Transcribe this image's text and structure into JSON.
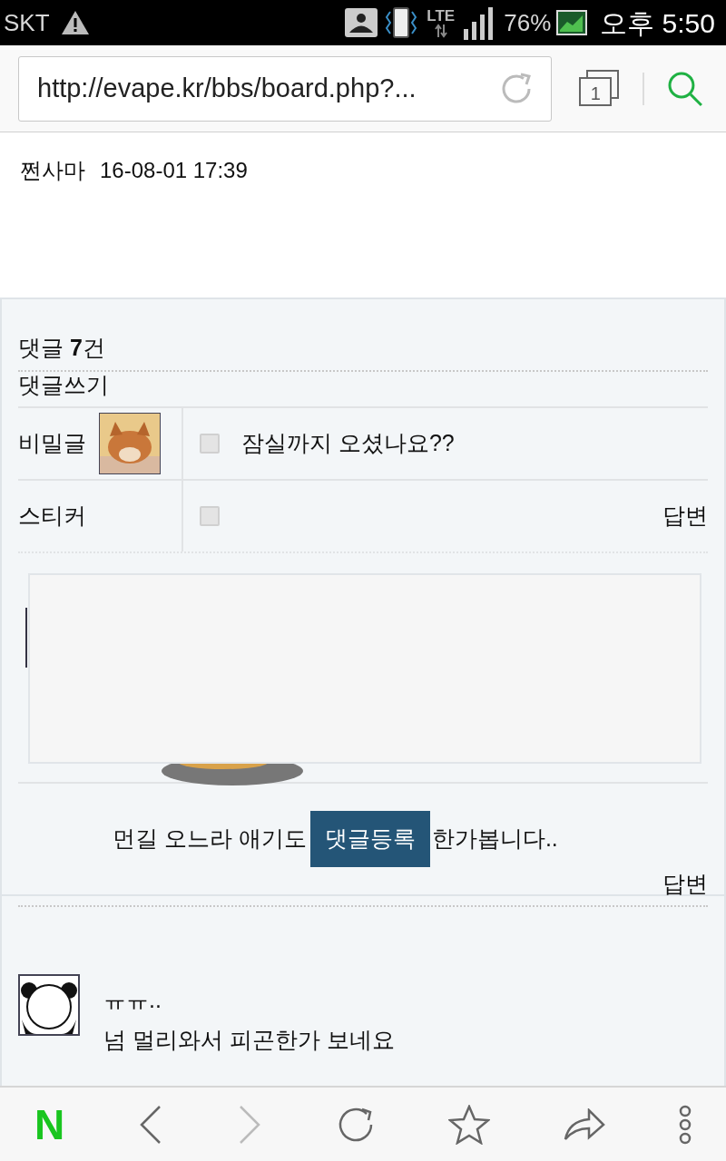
{
  "status_bar": {
    "carrier": "SKT",
    "network": "LTE",
    "battery": "76%",
    "time": "오후 5:50"
  },
  "address_bar": {
    "url": "http://evape.kr/bbs/board.php?...",
    "tab_count": "1"
  },
  "post_meta": {
    "author": "쩐사마",
    "date": "16-08-01 17:39"
  },
  "comment_form": {
    "count_label": "댓글 **7**건",
    "heading": "댓글쓰기",
    "options": [
      {
        "label": "비밀글",
        "checked": false
      },
      {
        "label": "스티커",
        "checked": false
      }
    ],
    "submit": "댓글등록"
  },
  "comments": [
    {
      "text_parts": [
        "잠실까지 오셨나요??"
      ],
      "reply": "답변"
    },
    {
      "text_parts": [
        "먼길 오느라 애기도",
        "한가봅니다.."
      ],
      "reply": "답변"
    },
    {
      "text_parts": [
        "ㅠㅠ..",
        "넘 멀리와서 피곤한가 보네요"
      ]
    }
  ],
  "bottom_toolbar": {
    "logo": "N"
  }
}
